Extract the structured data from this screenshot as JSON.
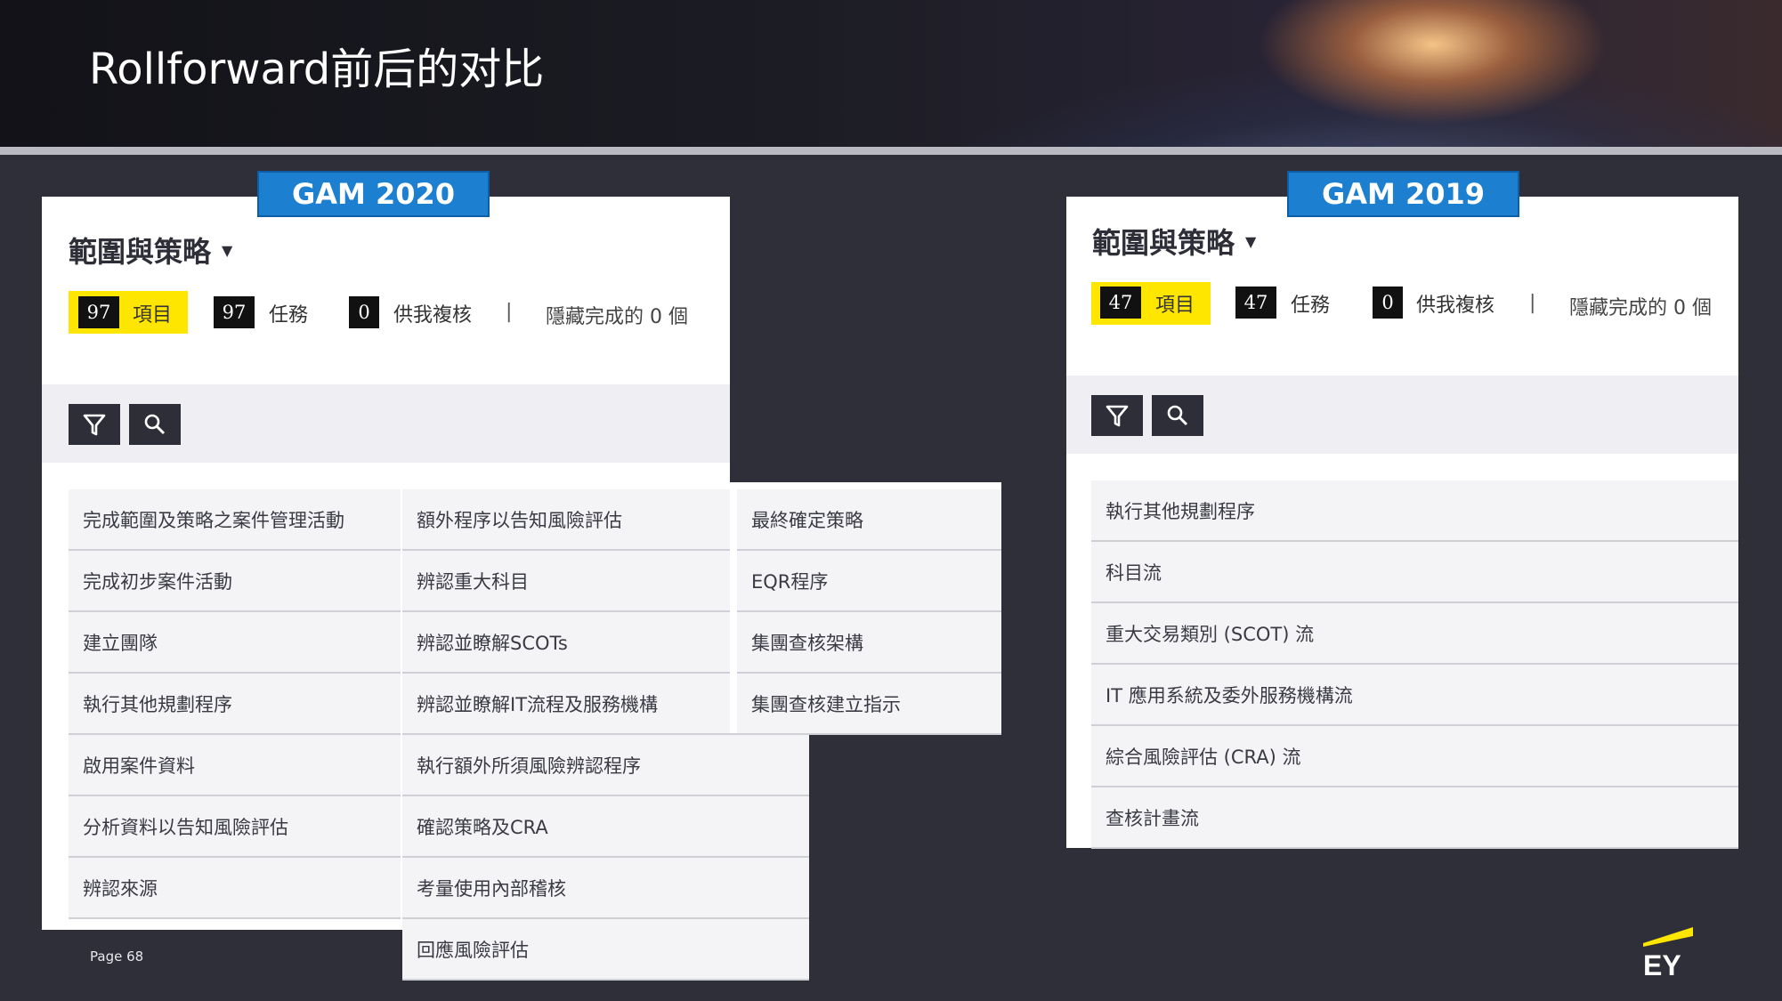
{
  "slide": {
    "title": "Rollforward前后的对比",
    "page": "Page 68",
    "logo": "EY"
  },
  "panel_2020": {
    "badge": "GAM 2020",
    "section_title": "範圍與策略",
    "stats": {
      "items_count": "97",
      "items_label": "項目",
      "tasks_count": "97",
      "tasks_label": "任務",
      "review_count": "0",
      "review_label": "供我複核",
      "separator": "|",
      "hide_completed": "隱藏完成的 0 個"
    },
    "col1": [
      "完成範圍及策略之案件管理活動",
      "完成初步案件活動",
      "建立團隊",
      "執行其他規劃程序",
      "啟用案件資料",
      "分析資料以告知風險評估",
      "辨認來源"
    ],
    "col2": [
      "額外程序以告知風險評估",
      "辨認重大科目",
      "辨認並瞭解SCOTs",
      "辨認並瞭解IT流程及服務機構",
      "執行額外所須風險辨認程序",
      "確認策略及CRA",
      "考量使用內部稽核",
      "回應風險評估"
    ],
    "col3": [
      "最終確定策略",
      "EQR程序",
      "集團查核架構",
      "集團查核建立指示"
    ]
  },
  "panel_2019": {
    "badge": "GAM 2019",
    "section_title": "範圍與策略",
    "stats": {
      "items_count": "47",
      "items_label": "項目",
      "tasks_count": "47",
      "tasks_label": "任務",
      "review_count": "0",
      "review_label": "供我複核",
      "separator": "|",
      "hide_completed": "隱藏完成的 0 個"
    },
    "list": [
      "執行其他規劃程序",
      "科目流",
      "重大交易類別 (SCOT) 流",
      "IT 應用系統及委外服務機構流",
      "綜合風險評估 (CRA) 流",
      "查核計畫流"
    ]
  },
  "icons": {
    "filter": "filter-icon",
    "search": "search-icon",
    "caret": "caret-down-icon"
  },
  "colors": {
    "ey_yellow": "#ffe600",
    "badge_blue": "#1d7fd0",
    "dark": "#2e2e38"
  }
}
